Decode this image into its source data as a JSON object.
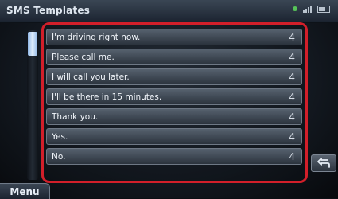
{
  "window": {
    "title": "SMS Templates"
  },
  "status_bar": {
    "icons": [
      "signal-icon",
      "bluetooth-icon",
      "battery-icon"
    ],
    "indicator_color": "#5bd35b"
  },
  "templates": [
    {
      "label": "I'm driving right now.",
      "end": "4"
    },
    {
      "label": "Please call me.",
      "end": "4"
    },
    {
      "label": "I will call you later.",
      "end": "4"
    },
    {
      "label": "I'll be there in 15 minutes.",
      "end": "4"
    },
    {
      "label": "Thank you.",
      "end": "4"
    },
    {
      "label": "Yes.",
      "end": "4"
    },
    {
      "label": "No.",
      "end": "4"
    }
  ],
  "buttons": {
    "menu_label": "Menu",
    "back_icon": "return-arrow-icon"
  },
  "colors": {
    "highlight": "#d21f2a",
    "scroll_thumb": "#e0eefc"
  }
}
